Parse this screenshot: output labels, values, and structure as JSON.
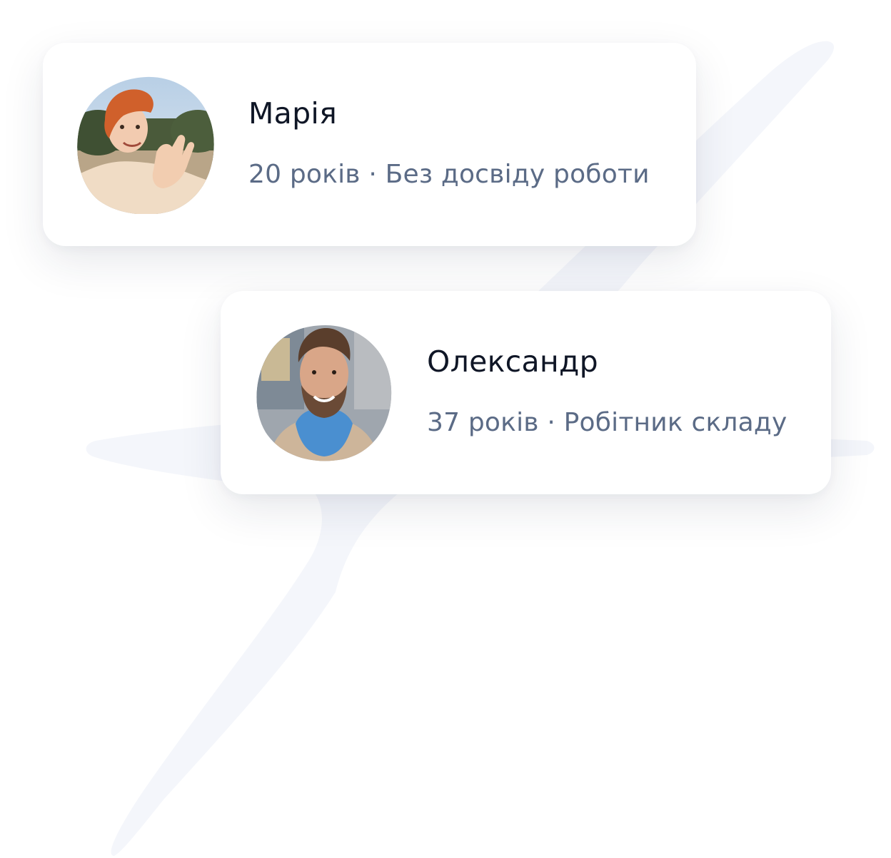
{
  "profiles": [
    {
      "name": "Марія",
      "details": "20 років · Без досвіду роботи"
    },
    {
      "name": "Олександр",
      "details": "37 років · Робітник складу"
    }
  ]
}
